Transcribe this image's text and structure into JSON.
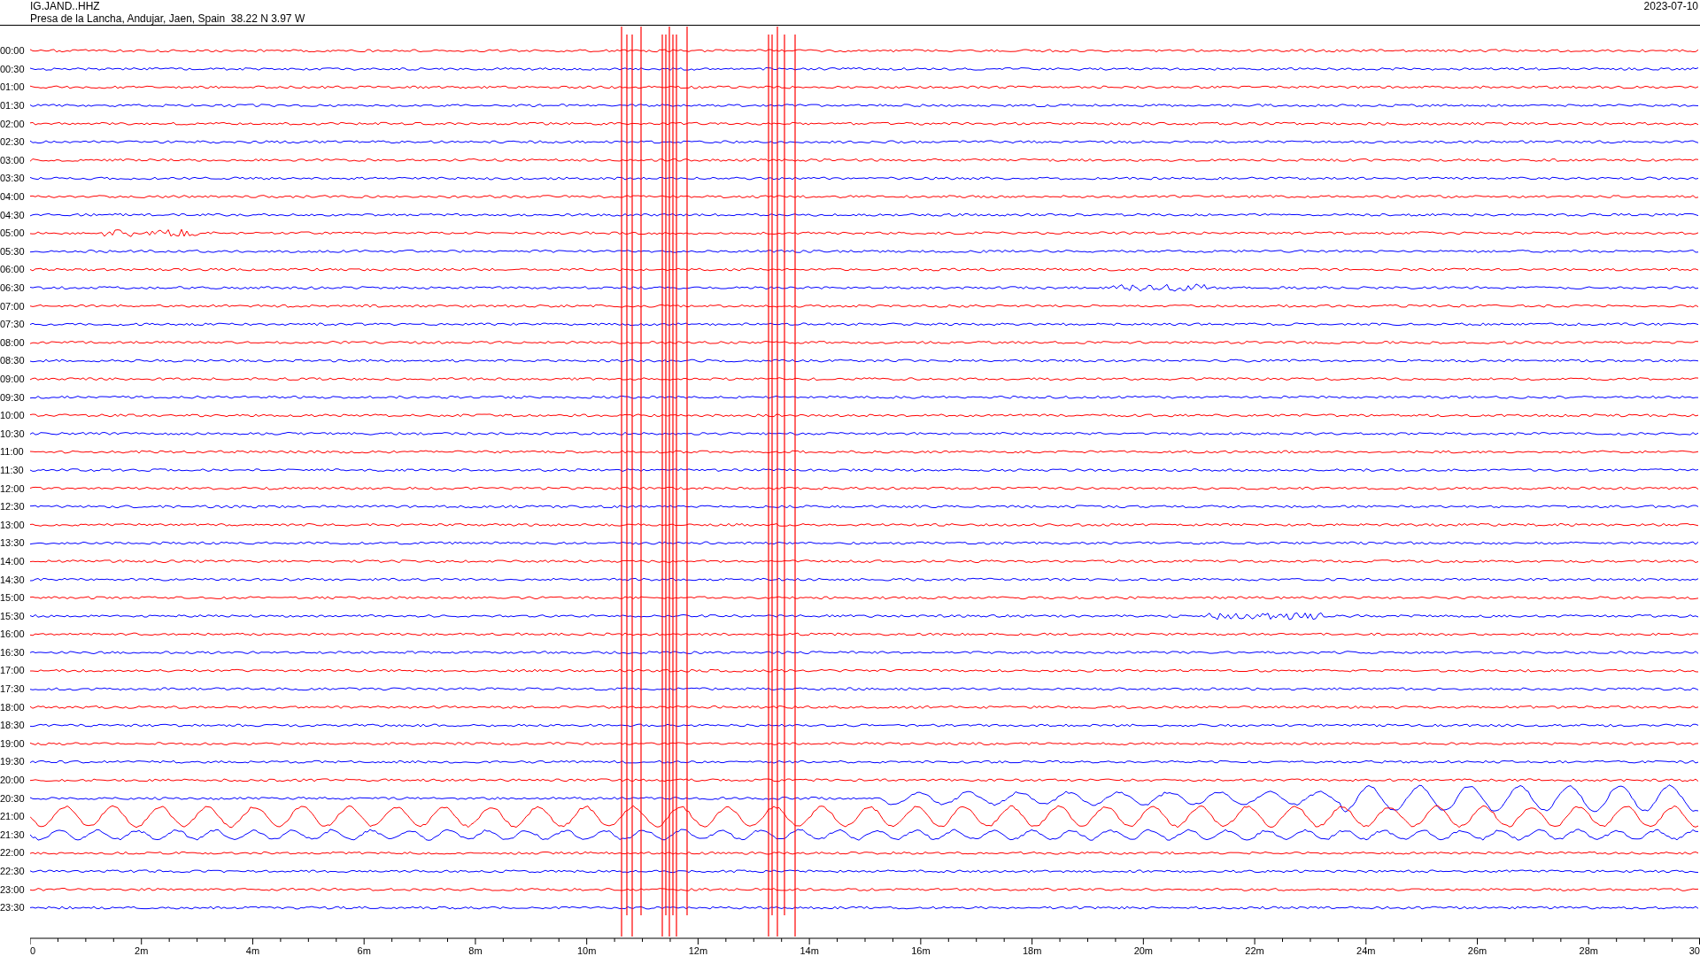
{
  "header": {
    "station": "IG.JAND..HHZ",
    "location": "Presa de la Lancha, Andujar, Jaen, Spain  38.22 N 3.97 W",
    "date": "2023-07-10"
  },
  "rows": [
    {
      "label": "00:00",
      "color": "#ff0000"
    },
    {
      "label": "00:30",
      "color": "#0000ff"
    },
    {
      "label": "01:00",
      "color": "#ff0000"
    },
    {
      "label": "01:30",
      "color": "#0000ff"
    },
    {
      "label": "02:00",
      "color": "#ff0000"
    },
    {
      "label": "02:30",
      "color": "#0000ff"
    },
    {
      "label": "03:00",
      "color": "#ff0000"
    },
    {
      "label": "03:30",
      "color": "#0000ff"
    },
    {
      "label": "04:00",
      "color": "#ff0000"
    },
    {
      "label": "04:30",
      "color": "#0000ff"
    },
    {
      "label": "05:00",
      "color": "#ff0000"
    },
    {
      "label": "05:30",
      "color": "#0000ff"
    },
    {
      "label": "06:00",
      "color": "#ff0000"
    },
    {
      "label": "06:30",
      "color": "#0000ff"
    },
    {
      "label": "07:00",
      "color": "#ff0000"
    },
    {
      "label": "07:30",
      "color": "#0000ff"
    },
    {
      "label": "08:00",
      "color": "#ff0000"
    },
    {
      "label": "08:30",
      "color": "#0000ff"
    },
    {
      "label": "09:00",
      "color": "#ff0000"
    },
    {
      "label": "09:30",
      "color": "#0000ff"
    },
    {
      "label": "10:00",
      "color": "#ff0000"
    },
    {
      "label": "10:30",
      "color": "#0000ff"
    },
    {
      "label": "11:00",
      "color": "#ff0000"
    },
    {
      "label": "11:30",
      "color": "#0000ff"
    },
    {
      "label": "12:00",
      "color": "#ff0000"
    },
    {
      "label": "12:30",
      "color": "#0000ff"
    },
    {
      "label": "13:00",
      "color": "#ff0000"
    },
    {
      "label": "13:30",
      "color": "#0000ff"
    },
    {
      "label": "14:00",
      "color": "#ff0000"
    },
    {
      "label": "14:30",
      "color": "#0000ff"
    },
    {
      "label": "15:00",
      "color": "#ff0000"
    },
    {
      "label": "15:30",
      "color": "#0000ff"
    },
    {
      "label": "16:00",
      "color": "#ff0000"
    },
    {
      "label": "16:30",
      "color": "#0000ff"
    },
    {
      "label": "17:00",
      "color": "#ff0000"
    },
    {
      "label": "17:30",
      "color": "#0000ff"
    },
    {
      "label": "18:00",
      "color": "#ff0000"
    },
    {
      "label": "18:30",
      "color": "#0000ff"
    },
    {
      "label": "19:00",
      "color": "#ff0000"
    },
    {
      "label": "19:30",
      "color": "#0000ff"
    },
    {
      "label": "20:00",
      "color": "#ff0000"
    },
    {
      "label": "20:30",
      "color": "#0000ff"
    },
    {
      "label": "21:00",
      "color": "#ff0000"
    },
    {
      "label": "21:30",
      "color": "#0000ff"
    },
    {
      "label": "22:00",
      "color": "#ff0000"
    },
    {
      "label": "22:30",
      "color": "#0000ff"
    },
    {
      "label": "23:00",
      "color": "#ff0000"
    },
    {
      "label": "23:30",
      "color": "#0000ff"
    }
  ],
  "x_axis": {
    "ticks": [
      "0",
      "2m",
      "4m",
      "6m",
      "8m",
      "10m",
      "12m",
      "14m",
      "16m",
      "18m",
      "20m",
      "22m",
      "24m",
      "26m",
      "28m",
      "30"
    ]
  }
}
